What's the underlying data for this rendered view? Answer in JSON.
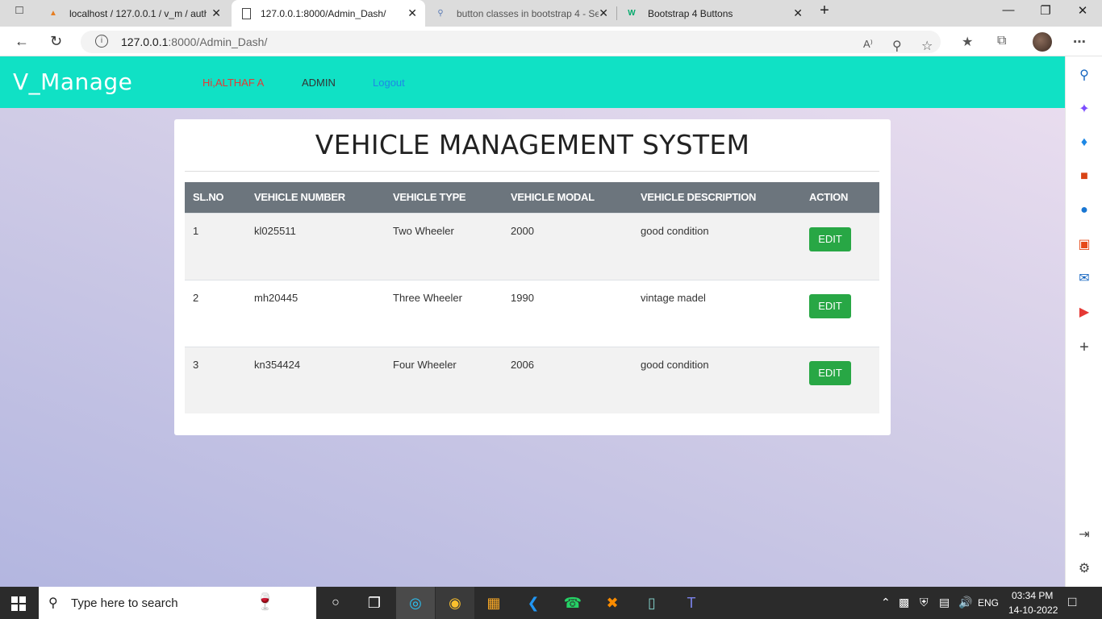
{
  "browser": {
    "tabs": [
      {
        "title": "localhost / 127.0.0.1 / v_m / auth",
        "icon": "phpmyadmin-icon"
      },
      {
        "title": "127.0.0.1:8000/Admin_Dash/",
        "icon": "page-icon"
      },
      {
        "title": "button classes in bootstrap 4 - Se",
        "icon": "search-icon"
      },
      {
        "title": "Bootstrap 4 Buttons",
        "icon": "w3schools-icon"
      }
    ],
    "url_host": "127.0.0.1",
    "url_rest": ":8000/Admin_Dash/"
  },
  "navbar": {
    "brand": "V_Manage",
    "greeting": "Hi,ALTHAF A",
    "admin": "ADMIN",
    "logout": "Logout"
  },
  "main": {
    "title": "VEHICLE MANAGEMENT SYSTEM",
    "columns": [
      "SL.NO",
      "VEHICLE NUMBER",
      "VEHICLE TYPE",
      "VEHICLE MODAL",
      "VEHICLE DESCRIPTION",
      "ACTION"
    ],
    "rows": [
      {
        "slno": "1",
        "number": "kl025511",
        "type": "Two Wheeler",
        "modal": "2000",
        "description": "good condition",
        "action": "EDIT"
      },
      {
        "slno": "2",
        "number": "mh20445",
        "type": "Three Wheeler",
        "modal": "1990",
        "description": "vintage madel",
        "action": "EDIT"
      },
      {
        "slno": "3",
        "number": "kn354424",
        "type": "Four Wheeler",
        "modal": "2006",
        "description": "good condition",
        "action": "EDIT"
      }
    ]
  },
  "taskbar": {
    "search_placeholder": "Type here to search",
    "lang": "ENG",
    "time": "03:34 PM",
    "date": "14-10-2022"
  },
  "colors": {
    "navbar": "#10e1c5",
    "edit_button": "#28a745",
    "table_header": "#6c757d",
    "greeting": "#e53935",
    "logout": "#1e88e5"
  }
}
